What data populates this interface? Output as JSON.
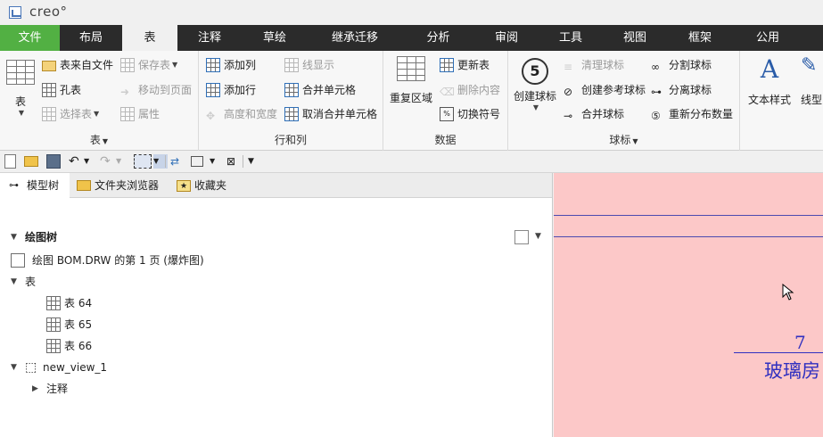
{
  "titlebar": {
    "brand": "creo°"
  },
  "tabs": [
    {
      "label": "文件"
    },
    {
      "label": "布局"
    },
    {
      "label": "表"
    },
    {
      "label": "注释"
    },
    {
      "label": "草绘"
    },
    {
      "label": "继承迁移"
    },
    {
      "label": "分析"
    },
    {
      "label": "审阅"
    },
    {
      "label": "工具"
    },
    {
      "label": "视图"
    },
    {
      "label": "框架"
    },
    {
      "label": "公用"
    }
  ],
  "ribbon": {
    "table_group": {
      "label": "表",
      "big": "表",
      "table_from_file": "表来自文件",
      "hole_table": "孔表",
      "select_table": "选择表",
      "save_table": "保存表",
      "move_to_page": "移动到页面",
      "properties": "属性"
    },
    "rows_cols_group": {
      "label": "行和列",
      "add_column": "添加列",
      "add_row": "添加行",
      "height_width": "高度和宽度",
      "line_display": "线显示",
      "merge_cells": "合并单元格",
      "unmerge_cells": "取消合并单元格"
    },
    "data_group": {
      "label": "数据",
      "repeat_region": "重复区域",
      "update_table": "更新表",
      "delete_content": "删除内容",
      "switch_symbol": "切换符号"
    },
    "balloon_group": {
      "label": "球标",
      "create_balloon": "创建球标",
      "balloon_glyph": "5",
      "clean_balloon": "清理球标",
      "create_ref_balloon": "创建参考球标",
      "merge_balloon": "合并球标",
      "split_balloon": "分割球标",
      "detach_balloon": "分离球标",
      "redistribute_qty": "重新分布数量"
    },
    "format_group": {
      "text_style": "文本样式",
      "line_style_partial": "线型",
      "text_glyph": "A"
    }
  },
  "panel": {
    "tabs": [
      {
        "label": "模型树"
      },
      {
        "label": "文件夹浏览器"
      },
      {
        "label": "收藏夹"
      }
    ],
    "tree": {
      "header": "绘图树",
      "page": "绘图 BOM.DRW 的第 1 页 (爆炸图)",
      "tables_node": "表",
      "tables": [
        "表 64",
        "表 65",
        "表 66"
      ],
      "view_node": "new_view_1",
      "annotations_node": "注释"
    }
  },
  "canvas": {
    "balloon_number": "7",
    "part_name": "玻璃房"
  },
  "colors": {
    "file_tab": "#52b043",
    "tab_bar": "#2b2b2b",
    "canvas_bg": "#fcc8c8",
    "drawing_ink": "#3030c0"
  }
}
